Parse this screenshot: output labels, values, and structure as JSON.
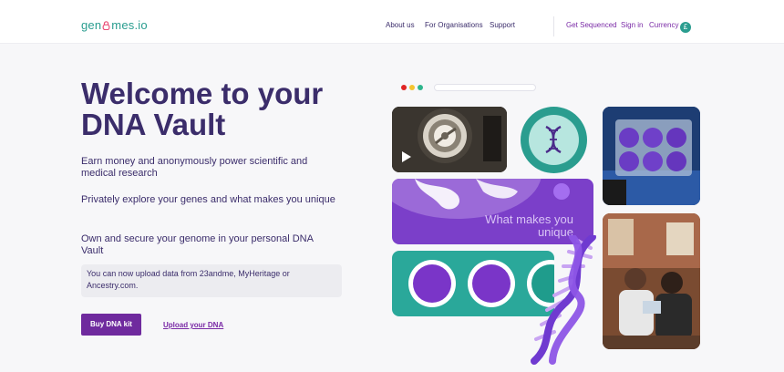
{
  "header": {
    "logo_text_pre": "gen",
    "logo_text_post": "mes.io",
    "nav": {
      "about": "About us",
      "organisations": "For Organisations",
      "support": "Support"
    },
    "get_sequenced": "Get Sequenced",
    "sign_in": "Sign in",
    "currency": "Currency",
    "currency_symbol": "£"
  },
  "hero": {
    "title": "Welcome to your DNA Vault",
    "points": [
      "Earn money and anonymously power scientific and medical research",
      "Privately explore your genes and what makes you unique",
      "Own and secure your genome in your personal DNA Vault"
    ],
    "notice": "You can now upload data from 23andme, MyHeritage or Ancestry.com.",
    "buy_label": "Buy DNA kit",
    "upload_label": "Upload your DNA"
  },
  "collage": {
    "purple_tile_text": "What makes you unique",
    "browser_dot_colors": [
      "#e02424",
      "#f4c430",
      "#2fb58c"
    ],
    "colors": {
      "brand_purple": "#3b2d6b",
      "accent_purple": "#6f2a9e",
      "teal": "#2a9d8f"
    }
  }
}
